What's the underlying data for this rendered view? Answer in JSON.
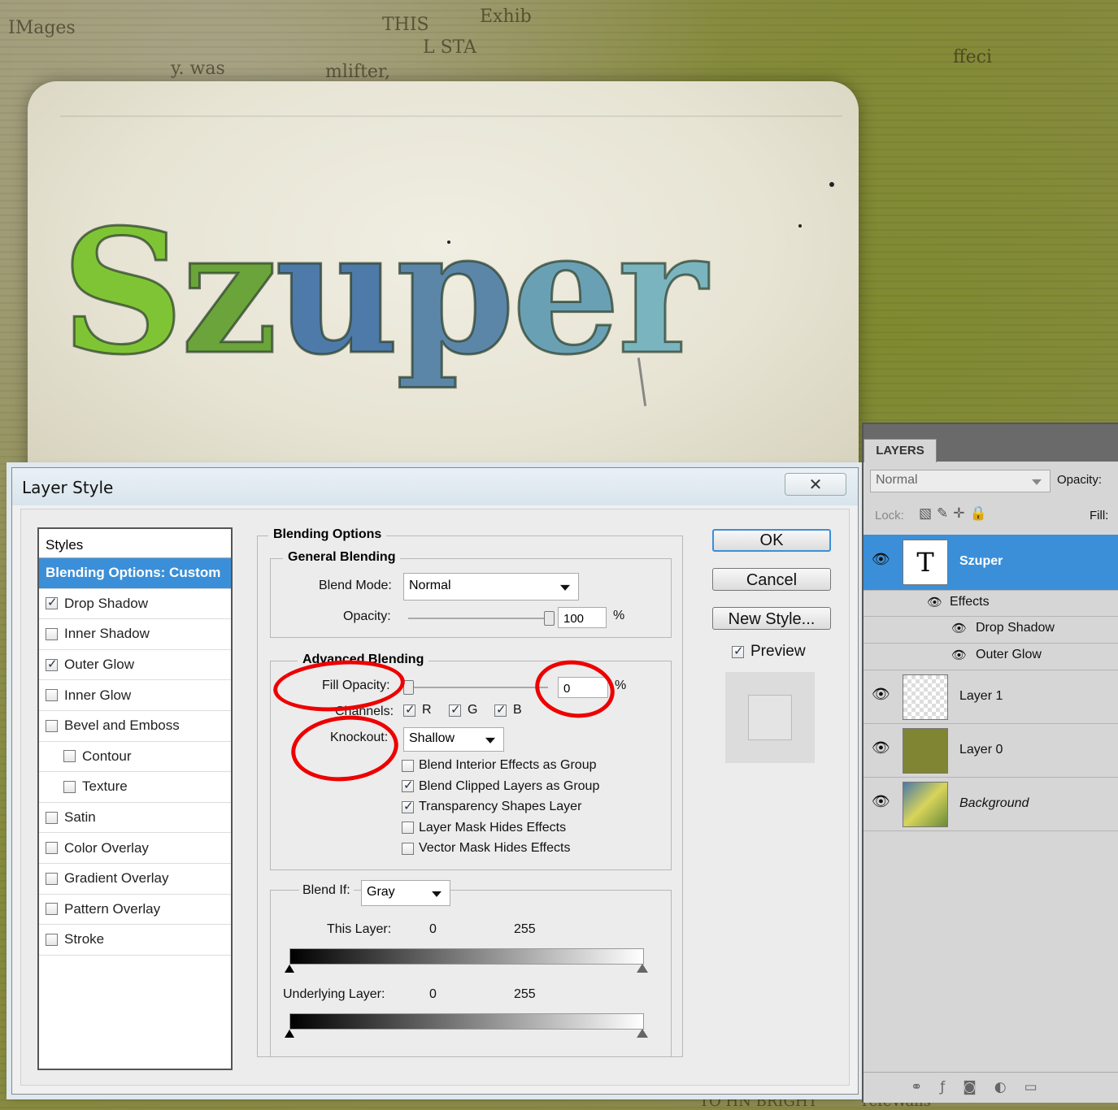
{
  "canvas": {
    "headline_text": "Szuper",
    "letter_colors": [
      "#7fc435",
      "#6aa43a",
      "#4d7aa8",
      "#5b86a8",
      "#6aa0b4",
      "#7ab5bf"
    ],
    "news_fragments": [
      "ffeci",
      "IMages",
      "THIS",
      "Exhib",
      "L STA",
      "y. was",
      "mlifter,",
      "TO HN BRIGHT",
      "refeWalls"
    ]
  },
  "dialog": {
    "title": "Layer Style",
    "close_glyph": "✕",
    "styles_header": "Styles",
    "styles": [
      {
        "label": "Blending Options: Custom",
        "checkbox": false,
        "checked": false,
        "active": true,
        "indent": false
      },
      {
        "label": "Drop Shadow",
        "checkbox": true,
        "checked": true,
        "active": false,
        "indent": false
      },
      {
        "label": "Inner Shadow",
        "checkbox": true,
        "checked": false,
        "active": false,
        "indent": false
      },
      {
        "label": "Outer Glow",
        "checkbox": true,
        "checked": true,
        "active": false,
        "indent": false
      },
      {
        "label": "Inner Glow",
        "checkbox": true,
        "checked": false,
        "active": false,
        "indent": false
      },
      {
        "label": "Bevel and Emboss",
        "checkbox": true,
        "checked": false,
        "active": false,
        "indent": false
      },
      {
        "label": "Contour",
        "checkbox": true,
        "checked": false,
        "active": false,
        "indent": true
      },
      {
        "label": "Texture",
        "checkbox": true,
        "checked": false,
        "active": false,
        "indent": true
      },
      {
        "label": "Satin",
        "checkbox": true,
        "checked": false,
        "active": false,
        "indent": false
      },
      {
        "label": "Color Overlay",
        "checkbox": true,
        "checked": false,
        "active": false,
        "indent": false
      },
      {
        "label": "Gradient Overlay",
        "checkbox": true,
        "checked": false,
        "active": false,
        "indent": false
      },
      {
        "label": "Pattern Overlay",
        "checkbox": true,
        "checked": false,
        "active": false,
        "indent": false
      },
      {
        "label": "Stroke",
        "checkbox": true,
        "checked": false,
        "active": false,
        "indent": false
      }
    ],
    "blending_options_title": "Blending Options",
    "general_blending_title": "General Blending",
    "blend_mode_label": "Blend Mode:",
    "blend_mode_value": "Normal",
    "opacity_label": "Opacity:",
    "opacity_value": "100",
    "percent": "%",
    "opacity_level": 1.0,
    "advanced_blending_title": "Advanced Blending",
    "fill_opacity_label": "Fill Opacity:",
    "fill_opacity_value": "0",
    "channels_label": "Channels:",
    "channels": [
      {
        "label": "R",
        "checked": true
      },
      {
        "label": "G",
        "checked": true
      },
      {
        "label": "B",
        "checked": true
      }
    ],
    "knockout_label": "Knockout:",
    "knockout_value": "Shallow",
    "options": [
      {
        "label": "Blend Interior Effects as Group",
        "checked": false
      },
      {
        "label": "Blend Clipped Layers as Group",
        "checked": true
      },
      {
        "label": "Transparency Shapes Layer",
        "checked": true
      },
      {
        "label": "Layer Mask Hides Effects",
        "checked": false
      },
      {
        "label": "Vector Mask Hides Effects",
        "checked": false
      }
    ],
    "blend_if_label": "Blend If:",
    "blend_if_value": "Gray",
    "this_layer_label": "This Layer:",
    "this_layer_low": "0",
    "this_layer_high": "255",
    "underlying_label": "Underlying Layer:",
    "underlying_low": "0",
    "underlying_high": "255",
    "ok_label": "OK",
    "cancel_label": "Cancel",
    "new_style_label": "New Style...",
    "preview_label": "Preview",
    "preview_checked": true,
    "highlight_color": "#e00000"
  },
  "layers_panel": {
    "tab_label": "LAYERS",
    "blend_mode": "Normal",
    "opacity_label": "Opacity:",
    "lock_label": "Lock:",
    "fill_label": "Fill:",
    "selected_color": "#3b8fd8",
    "layers": [
      {
        "name": "Szuper",
        "type": "text",
        "selected": true
      },
      {
        "name": "Layer 1",
        "type": "transparent",
        "selected": false
      },
      {
        "name": "Layer 0",
        "type": "olive",
        "selected": false
      },
      {
        "name": "Background",
        "type": "image",
        "selected": false
      }
    ],
    "effects_label": "Effects",
    "effects": [
      "Drop Shadow",
      "Outer Glow"
    ],
    "footer_icons": [
      "link-icon",
      "fx-icon",
      "mask-icon",
      "adjustment-icon",
      "folder-icon",
      "new-layer-icon"
    ]
  }
}
